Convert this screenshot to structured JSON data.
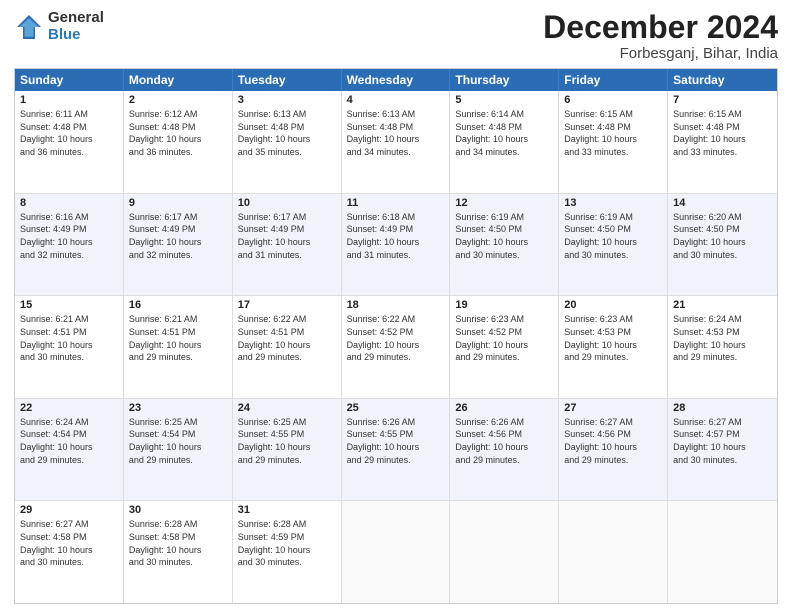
{
  "logo": {
    "general": "General",
    "blue": "Blue"
  },
  "title": "December 2024",
  "location": "Forbesganj, Bihar, India",
  "days_of_week": [
    "Sunday",
    "Monday",
    "Tuesday",
    "Wednesday",
    "Thursday",
    "Friday",
    "Saturday"
  ],
  "weeks": [
    [
      {
        "day": "1",
        "info": "Sunrise: 6:11 AM\nSunset: 4:48 PM\nDaylight: 10 hours\nand 36 minutes."
      },
      {
        "day": "2",
        "info": "Sunrise: 6:12 AM\nSunset: 4:48 PM\nDaylight: 10 hours\nand 36 minutes."
      },
      {
        "day": "3",
        "info": "Sunrise: 6:13 AM\nSunset: 4:48 PM\nDaylight: 10 hours\nand 35 minutes."
      },
      {
        "day": "4",
        "info": "Sunrise: 6:13 AM\nSunset: 4:48 PM\nDaylight: 10 hours\nand 34 minutes."
      },
      {
        "day": "5",
        "info": "Sunrise: 6:14 AM\nSunset: 4:48 PM\nDaylight: 10 hours\nand 34 minutes."
      },
      {
        "day": "6",
        "info": "Sunrise: 6:15 AM\nSunset: 4:48 PM\nDaylight: 10 hours\nand 33 minutes."
      },
      {
        "day": "7",
        "info": "Sunrise: 6:15 AM\nSunset: 4:48 PM\nDaylight: 10 hours\nand 33 minutes."
      }
    ],
    [
      {
        "day": "8",
        "info": "Sunrise: 6:16 AM\nSunset: 4:49 PM\nDaylight: 10 hours\nand 32 minutes."
      },
      {
        "day": "9",
        "info": "Sunrise: 6:17 AM\nSunset: 4:49 PM\nDaylight: 10 hours\nand 32 minutes."
      },
      {
        "day": "10",
        "info": "Sunrise: 6:17 AM\nSunset: 4:49 PM\nDaylight: 10 hours\nand 31 minutes."
      },
      {
        "day": "11",
        "info": "Sunrise: 6:18 AM\nSunset: 4:49 PM\nDaylight: 10 hours\nand 31 minutes."
      },
      {
        "day": "12",
        "info": "Sunrise: 6:19 AM\nSunset: 4:50 PM\nDaylight: 10 hours\nand 30 minutes."
      },
      {
        "day": "13",
        "info": "Sunrise: 6:19 AM\nSunset: 4:50 PM\nDaylight: 10 hours\nand 30 minutes."
      },
      {
        "day": "14",
        "info": "Sunrise: 6:20 AM\nSunset: 4:50 PM\nDaylight: 10 hours\nand 30 minutes."
      }
    ],
    [
      {
        "day": "15",
        "info": "Sunrise: 6:21 AM\nSunset: 4:51 PM\nDaylight: 10 hours\nand 30 minutes."
      },
      {
        "day": "16",
        "info": "Sunrise: 6:21 AM\nSunset: 4:51 PM\nDaylight: 10 hours\nand 29 minutes."
      },
      {
        "day": "17",
        "info": "Sunrise: 6:22 AM\nSunset: 4:51 PM\nDaylight: 10 hours\nand 29 minutes."
      },
      {
        "day": "18",
        "info": "Sunrise: 6:22 AM\nSunset: 4:52 PM\nDaylight: 10 hours\nand 29 minutes."
      },
      {
        "day": "19",
        "info": "Sunrise: 6:23 AM\nSunset: 4:52 PM\nDaylight: 10 hours\nand 29 minutes."
      },
      {
        "day": "20",
        "info": "Sunrise: 6:23 AM\nSunset: 4:53 PM\nDaylight: 10 hours\nand 29 minutes."
      },
      {
        "day": "21",
        "info": "Sunrise: 6:24 AM\nSunset: 4:53 PM\nDaylight: 10 hours\nand 29 minutes."
      }
    ],
    [
      {
        "day": "22",
        "info": "Sunrise: 6:24 AM\nSunset: 4:54 PM\nDaylight: 10 hours\nand 29 minutes."
      },
      {
        "day": "23",
        "info": "Sunrise: 6:25 AM\nSunset: 4:54 PM\nDaylight: 10 hours\nand 29 minutes."
      },
      {
        "day": "24",
        "info": "Sunrise: 6:25 AM\nSunset: 4:55 PM\nDaylight: 10 hours\nand 29 minutes."
      },
      {
        "day": "25",
        "info": "Sunrise: 6:26 AM\nSunset: 4:55 PM\nDaylight: 10 hours\nand 29 minutes."
      },
      {
        "day": "26",
        "info": "Sunrise: 6:26 AM\nSunset: 4:56 PM\nDaylight: 10 hours\nand 29 minutes."
      },
      {
        "day": "27",
        "info": "Sunrise: 6:27 AM\nSunset: 4:56 PM\nDaylight: 10 hours\nand 29 minutes."
      },
      {
        "day": "28",
        "info": "Sunrise: 6:27 AM\nSunset: 4:57 PM\nDaylight: 10 hours\nand 30 minutes."
      }
    ],
    [
      {
        "day": "29",
        "info": "Sunrise: 6:27 AM\nSunset: 4:58 PM\nDaylight: 10 hours\nand 30 minutes."
      },
      {
        "day": "30",
        "info": "Sunrise: 6:28 AM\nSunset: 4:58 PM\nDaylight: 10 hours\nand 30 minutes."
      },
      {
        "day": "31",
        "info": "Sunrise: 6:28 AM\nSunset: 4:59 PM\nDaylight: 10 hours\nand 30 minutes."
      },
      {
        "day": "",
        "info": ""
      },
      {
        "day": "",
        "info": ""
      },
      {
        "day": "",
        "info": ""
      },
      {
        "day": "",
        "info": ""
      }
    ]
  ]
}
